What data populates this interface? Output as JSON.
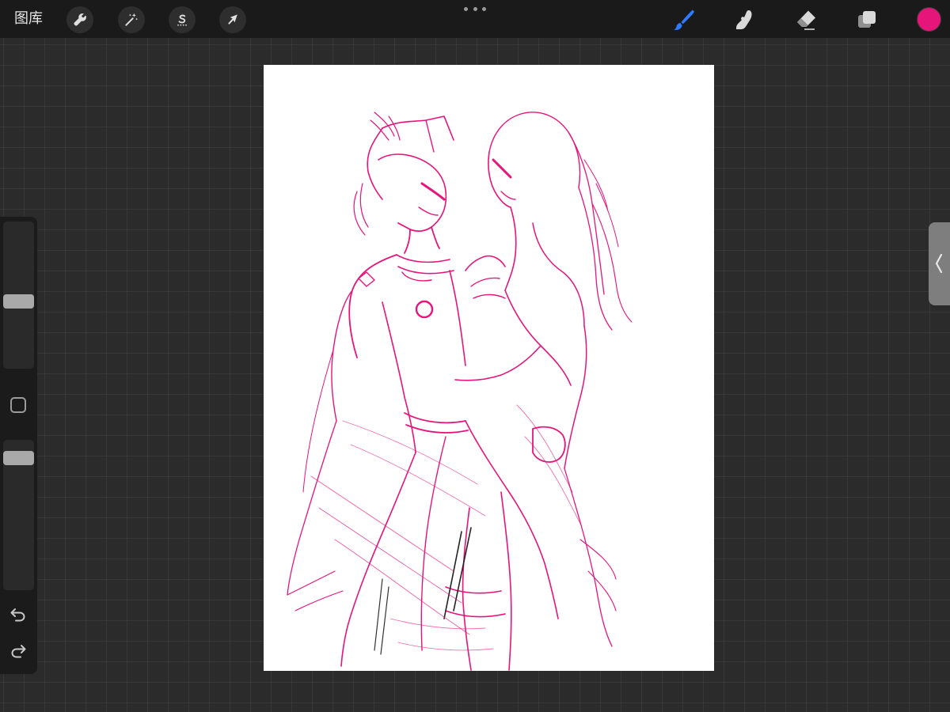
{
  "topbar": {
    "gallery_label": "图库",
    "left_tools": [
      {
        "name": "actions",
        "icon": "wrench-icon"
      },
      {
        "name": "adjustments",
        "icon": "magic-wand-icon"
      },
      {
        "name": "selection",
        "icon": "selection-s-icon"
      },
      {
        "name": "transform",
        "icon": "arrow-cursor-icon"
      }
    ],
    "more_icon": "three-dots-icon",
    "right_tools": [
      {
        "name": "brush",
        "icon": "brush-icon",
        "active": true
      },
      {
        "name": "smudge",
        "icon": "smudge-finger-icon",
        "active": false
      },
      {
        "name": "eraser",
        "icon": "eraser-icon",
        "active": false
      },
      {
        "name": "layers",
        "icon": "layers-icon",
        "active": false
      }
    ],
    "current_color": "#e6157a"
  },
  "sidebar": {
    "brush_size_level": 0.45,
    "brush_opacity_level": 0.95,
    "modify_icon": "square-modify-icon",
    "undo_icon": "undo-icon",
    "redo_icon": "redo-icon"
  },
  "canvas": {
    "background": "#ffffff",
    "ink_color": "#e6157a",
    "content": "sketch-of-two-figures-embracing"
  },
  "colors": {
    "app_bg": "#2b2b2b",
    "topbar_bg": "#1a1a1a",
    "accent_blue": "#2f7bff",
    "icon_light": "#d9d9d9"
  }
}
